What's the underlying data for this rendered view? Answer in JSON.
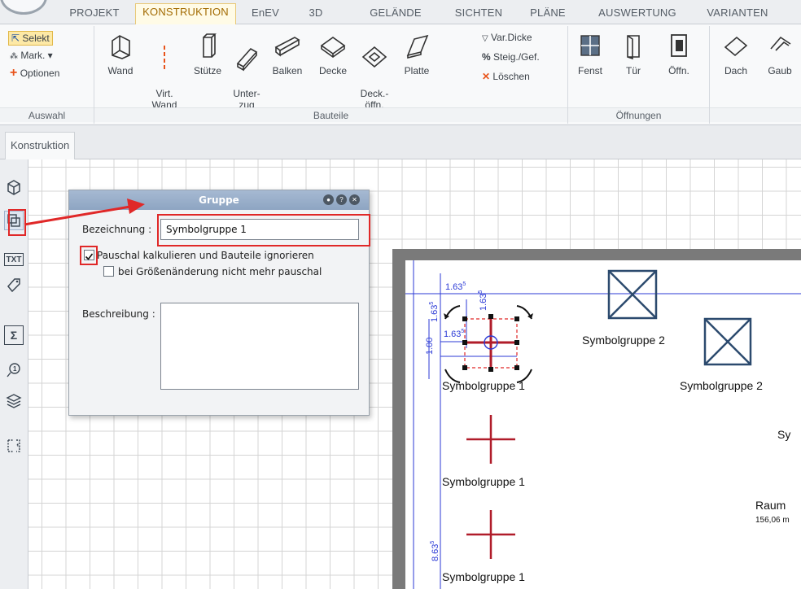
{
  "tabs": [
    {
      "label": "PROJEKT",
      "active": false
    },
    {
      "label": "KONSTRUKTION",
      "active": true
    },
    {
      "label": "EnEV",
      "active": false
    },
    {
      "label": "3D",
      "active": false
    },
    {
      "label": "GELÄNDE",
      "active": false
    },
    {
      "label": "SICHTEN",
      "active": false
    },
    {
      "label": "PLÄNE",
      "active": false
    },
    {
      "label": "AUSWERTUNG",
      "active": false
    },
    {
      "label": "VARIANTEN",
      "active": false
    }
  ],
  "ribbon": {
    "auswahl": {
      "label": "Auswahl",
      "selekt": "Selekt",
      "mark": "Mark. ▾",
      "optionen": "Optionen"
    },
    "bauteile": {
      "label": "Bauteile",
      "wand": "Wand",
      "virt_wand": "Virt.\nWand",
      "stuetze": "Stütze",
      "unterzug": "Unter-\nzug",
      "balken": "Balken",
      "decke": "Decke",
      "deckoeffn": "Deck.-\nöffn.",
      "platte": "Platte",
      "var_dicke": "Var.Dicke",
      "steig": "Steig./Gef.",
      "loeschen": "Löschen"
    },
    "oeffnungen": {
      "label": "Öffnungen",
      "fenst": "Fenst",
      "tuer": "Tür",
      "oeffn": "Öffn."
    },
    "dach": {
      "dach": "Dach",
      "gaube": "Gaub"
    }
  },
  "doc_tab": "Konstruktion",
  "left_tools": {
    "txt": "TXT",
    "sigma": "Σ"
  },
  "dialog": {
    "title": "Gruppe",
    "bezeichnung_label": "Bezeichnung :",
    "bezeichnung_value": "Symbolgruppe 1",
    "pauschal_label": "Pauschal kalkulieren und Bauteile ignorieren",
    "pauschal_checked": true,
    "groesse_label": "bei Größenänderung nicht mehr pauschal",
    "groesse_checked": false,
    "beschreibung_label": "Beschreibung :"
  },
  "plan": {
    "labels": {
      "sg1_a": "Symbolgruppe 1",
      "sg1_b": "Symbolgruppe 1",
      "sg1_c": "Symbolgruppe 1",
      "sg2_a": "Symbolgruppe 2",
      "sg2_b": "Symbolgruppe 2",
      "sy_partial": "Sy",
      "raum": "Raum",
      "area": "156,06 m"
    },
    "dims": {
      "d1": "1.63",
      "d1_sup": "5",
      "d2": "1.63",
      "d2_sup": "5",
      "d3": "1.63",
      "d3_sup": "5",
      "d4": "1.63",
      "d4_sup": "5",
      "d5": "1.00",
      "d6": "8.63",
      "d6_sup": "5"
    }
  },
  "colors": {
    "annotation_red": "#e02828",
    "dim_blue": "#2b3ad6",
    "symbol_red": "#b01c2a",
    "symbol_blue": "#2c4a6e"
  }
}
